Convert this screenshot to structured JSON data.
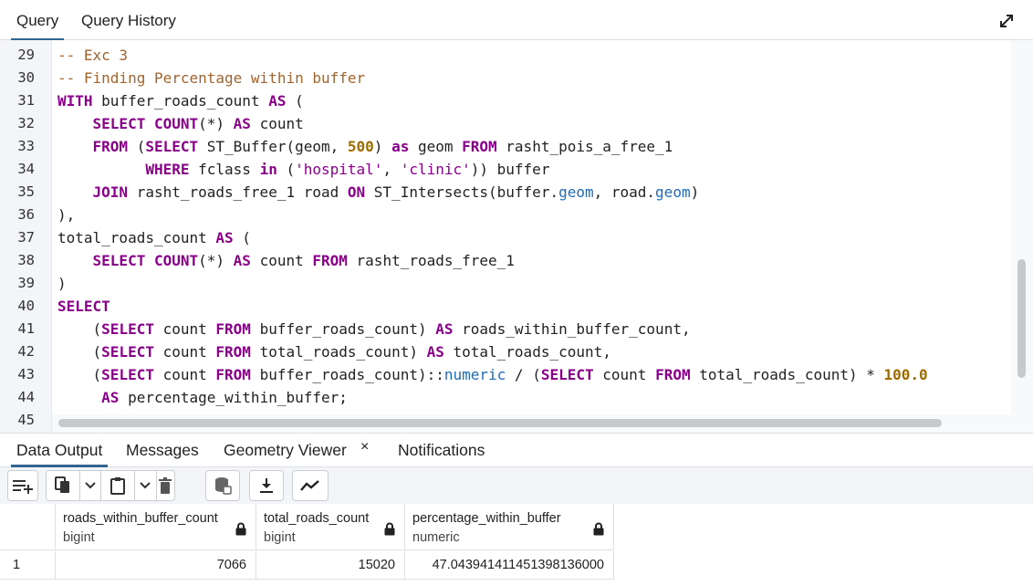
{
  "top_tabs": [
    {
      "label": "Query",
      "active": true
    },
    {
      "label": "Query History",
      "active": false
    }
  ],
  "editor": {
    "line_numbers": [
      "29",
      "30",
      "31",
      "32",
      "33",
      "34",
      "35",
      "36",
      "37",
      "38",
      "39",
      "40",
      "41",
      "42",
      "43",
      "44",
      "45"
    ],
    "code_lines": [
      "-- Exc 3",
      "-- Finding Percentage within buffer",
      "WITH buffer_roads_count AS (",
      "    SELECT COUNT(*) AS count",
      "    FROM (SELECT ST_Buffer(geom, 500) as geom FROM rasht_pois_a_free_1",
      "          WHERE fclass in ('hospital', 'clinic')) buffer",
      "    JOIN rasht_roads_free_1 road ON ST_Intersects(buffer.geom, road.geom)",
      "),",
      "total_roads_count AS (",
      "    SELECT COUNT(*) AS count FROM rasht_roads_free_1",
      ")",
      "SELECT",
      "    (SELECT count FROM buffer_roads_count) AS roads_within_buffer_count,",
      "    (SELECT count FROM total_roads_count) AS total_roads_count,",
      "    (SELECT count FROM buffer_roads_count)::numeric / (SELECT count FROM total_roads_count) * 100.0",
      "     AS percentage_within_buffer;",
      ""
    ]
  },
  "bottom_tabs": [
    {
      "label": "Data Output",
      "active": true
    },
    {
      "label": "Messages",
      "active": false
    },
    {
      "label": "Geometry Viewer",
      "active": false,
      "closable": true,
      "close_glyph": "×"
    },
    {
      "label": "Notifications",
      "active": false
    }
  ],
  "toolbar": {
    "icons": [
      "add-row-icon",
      "copy-icon",
      "chevron-down-icon",
      "paste-icon",
      "chevron-down-icon",
      "delete-icon",
      "save-data-icon",
      "download-icon",
      "graph-visualiser-icon"
    ]
  },
  "grid": {
    "columns": [
      {
        "name": "roads_within_buffer_count",
        "type": "bigint"
      },
      {
        "name": "total_roads_count",
        "type": "bigint"
      },
      {
        "name": "percentage_within_buffer",
        "type": "numeric"
      }
    ],
    "rows": [
      {
        "row_number": "1",
        "values": [
          "7066",
          "15020",
          "47.043941411451398136000"
        ]
      }
    ]
  },
  "colors": {
    "accent": "#326690",
    "keyword": "#8b008b",
    "comment": "#a0642e",
    "number": "#9e6b00",
    "property": "#1e6bb8"
  }
}
